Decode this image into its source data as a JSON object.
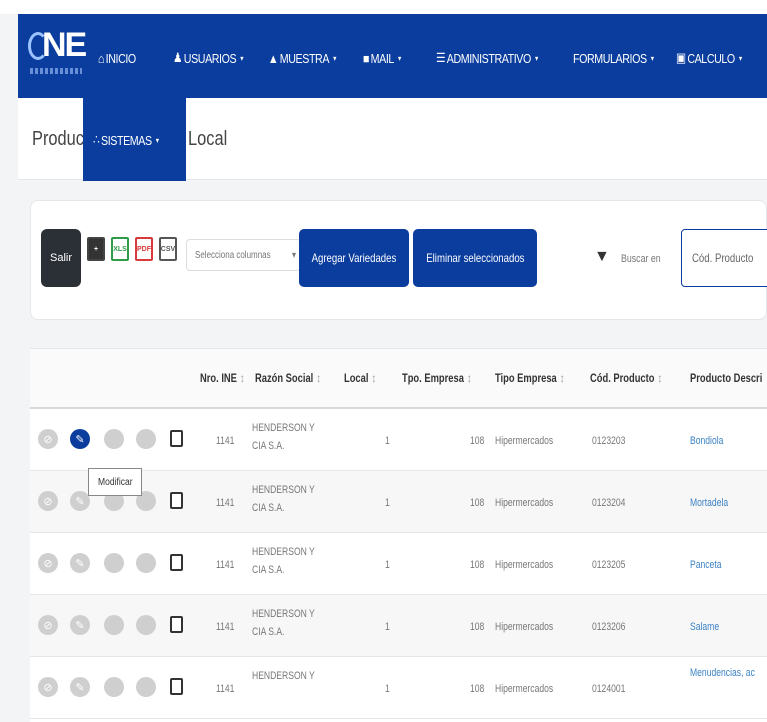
{
  "navbar": {
    "items": [
      {
        "label": "INICIO",
        "icon": "home-icon",
        "glyph": "⌂",
        "caret": ""
      },
      {
        "label": "USUARIOS",
        "icon": "users-icon",
        "glyph": "♟",
        "caret": "▾"
      },
      {
        "label": "MUESTRA",
        "icon": "sample-icon",
        "glyph": "▲",
        "caret": "▾"
      },
      {
        "label": "MAIL",
        "icon": "mail-icon",
        "glyph": "■",
        "caret": "▾"
      },
      {
        "label": "ADMINISTRATIVO",
        "icon": "list-icon",
        "glyph": "☰",
        "caret": "▾"
      },
      {
        "label": "FORMULARIOS",
        "icon": "",
        "glyph": "",
        "caret": "▾"
      },
      {
        "label": "CALCULO",
        "icon": "calculator-icon",
        "glyph": "▣",
        "caret": "▾"
      }
    ],
    "dropdown_item": {
      "label": "SISTEMAS",
      "icon": "sitemap-icon",
      "glyph": "∴",
      "caret": "▾"
    }
  },
  "page": {
    "title_left": "Product",
    "title_right": "Local"
  },
  "toolbar": {
    "salir": "Salir",
    "export_icons": [
      "+",
      "XLS",
      "PDF",
      "CSV"
    ],
    "columns_select": "Selecciona columnas",
    "columns_caret": "▾",
    "agregar_variedades": "Agregar Variedades",
    "eliminar_seleccionados": "Eliminar seleccionados",
    "filter_glyph": "▼",
    "buscar_label": "Buscar en",
    "search_placeholder": "Cód. Producto"
  },
  "table": {
    "columns": [
      {
        "label": "Nro. INE",
        "sort": "↕"
      },
      {
        "label": "Razón Social",
        "sort": "↕"
      },
      {
        "label": "Local",
        "sort": "↕"
      },
      {
        "label": "Tpo. Empresa",
        "sort": "↕"
      },
      {
        "label": "Tipo Empresa",
        "sort": "↕"
      },
      {
        "label": "Cód. Producto",
        "sort": "↕"
      },
      {
        "label": "Producto Descri",
        "sort": ""
      }
    ],
    "rows": [
      {
        "ine": "1141",
        "razon": "HENDERSON Y CIA S.A.",
        "local": "1",
        "tpo": "108",
        "tipo": "Hipermercados",
        "cod": "0123203",
        "producto": "Bondiola"
      },
      {
        "ine": "1141",
        "razon": "HENDERSON Y CIA S.A.",
        "local": "1",
        "tpo": "108",
        "tipo": "Hipermercados",
        "cod": "0123204",
        "producto": "Mortadela"
      },
      {
        "ine": "1141",
        "razon": "HENDERSON Y CIA S.A.",
        "local": "1",
        "tpo": "108",
        "tipo": "Hipermercados",
        "cod": "0123205",
        "producto": "Panceta"
      },
      {
        "ine": "1141",
        "razon": "HENDERSON Y CIA S.A.",
        "local": "1",
        "tpo": "108",
        "tipo": "Hipermercados",
        "cod": "0123206",
        "producto": "Salame"
      },
      {
        "ine": "1141",
        "razon": "HENDERSON Y",
        "local": "1",
        "tpo": "108",
        "tipo": "Hipermercados",
        "cod": "0124001",
        "producto": "Menudencias, ac"
      }
    ]
  },
  "tooltip": {
    "text": "Modificar"
  },
  "colors": {
    "brand": "#0a3d9e",
    "link": "#3b82c4"
  }
}
